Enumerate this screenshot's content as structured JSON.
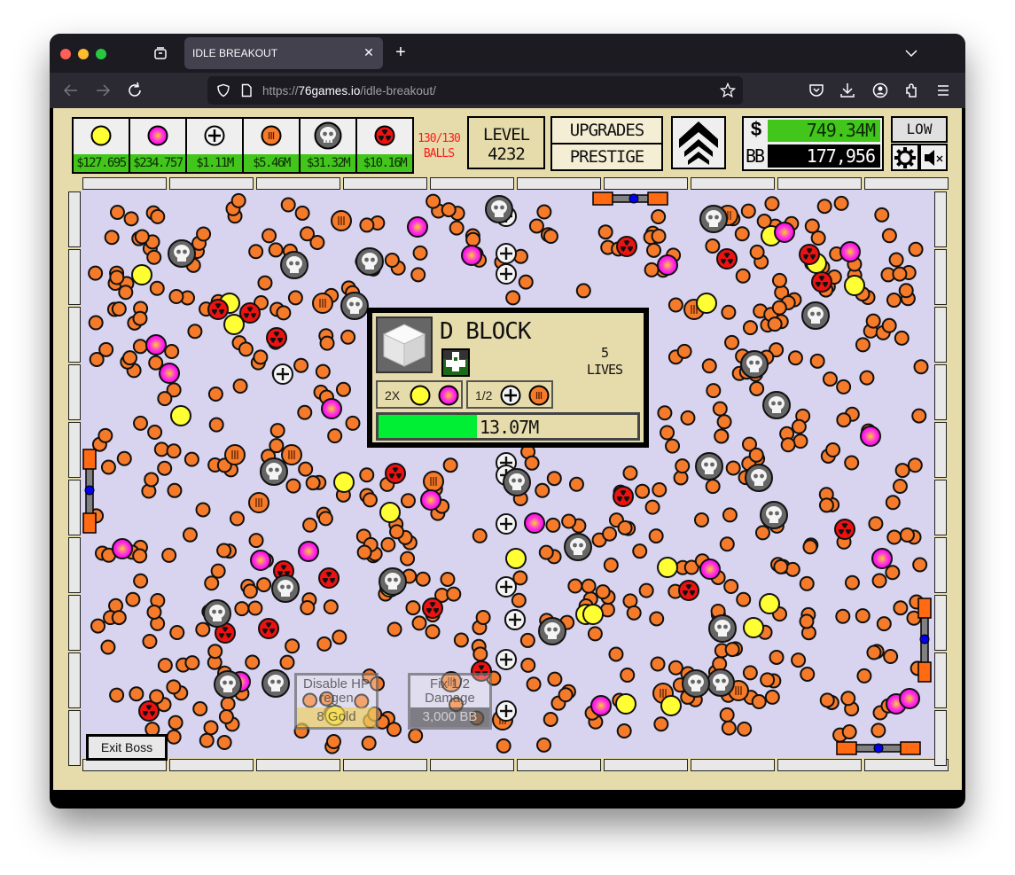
{
  "browser": {
    "tab_title": "IDLE BREAKOUT",
    "url_prefix": "https://",
    "url_domain": "76games.io",
    "url_path": "/idle-breakout/",
    "icons": [
      "tab-overview-icon",
      "close-tab-icon",
      "new-tab-icon",
      "list-all-tabs-icon",
      "back-icon",
      "forward-icon",
      "reload-icon",
      "shield-icon",
      "page-icon",
      "bookmark-star-icon",
      "pocket-icon",
      "download-icon",
      "account-icon",
      "extensions-icon",
      "menu-icon"
    ]
  },
  "shop": {
    "items": [
      {
        "ball": "basic",
        "icon": "yellow-ball-icon",
        "price": "$127.695"
      },
      {
        "ball": "plasma",
        "icon": "magenta-plasma-ball-icon",
        "price": "$234.757"
      },
      {
        "ball": "sniper",
        "icon": "crosshair-plus-ball-icon",
        "price": "$1.11M"
      },
      {
        "ball": "scatter",
        "icon": "orange-scatter-ball-icon",
        "price": "$5.46M"
      },
      {
        "ball": "cannon",
        "icon": "skull-ball-icon",
        "price": "$31.32M"
      },
      {
        "ball": "poison",
        "icon": "radiation-ball-icon",
        "price": "$10.16M"
      }
    ]
  },
  "balls_count": {
    "line1": "130/130",
    "line2": "BALLS"
  },
  "level": {
    "label": "LEVEL",
    "value": "4232"
  },
  "menu": {
    "upgrades": "UPGRADES",
    "prestige": "PRESTIGE"
  },
  "currency": {
    "money_symbol": "$",
    "money": "749.34M",
    "bb_label": "BB",
    "bb": "177,956"
  },
  "options": {
    "quality": "LOW"
  },
  "boss_popup": {
    "title": "D BLOCK",
    "lives_value": "5",
    "lives_label": "LIVES",
    "mod1_label": "2X",
    "mod2_label": "1/2",
    "hp_text": "13.07M",
    "hp_fraction": 0.38
  },
  "boss_options": {
    "disable_regen_line1": "Disable HP",
    "disable_regen_line2": "regen",
    "disable_regen_cost": "8 Gold",
    "fix_damage_line1": "Fix 1/2",
    "fix_damage_line2": "Damage",
    "fix_damage_cost": "3,000 BB",
    "exit_boss": "Exit Boss"
  },
  "colors": {
    "game_bg": "#e6dbab",
    "field_bg": "#d8d3ef",
    "price_green": "#42c61c",
    "scatter_orange": "#f57a2a",
    "basic_yellow": "#ffff33",
    "plasma_magenta": "#ff22ee",
    "poison_red": "#ee1111",
    "paddle_orange": "#ff6a13",
    "paddle_dot": "#0000ee"
  }
}
